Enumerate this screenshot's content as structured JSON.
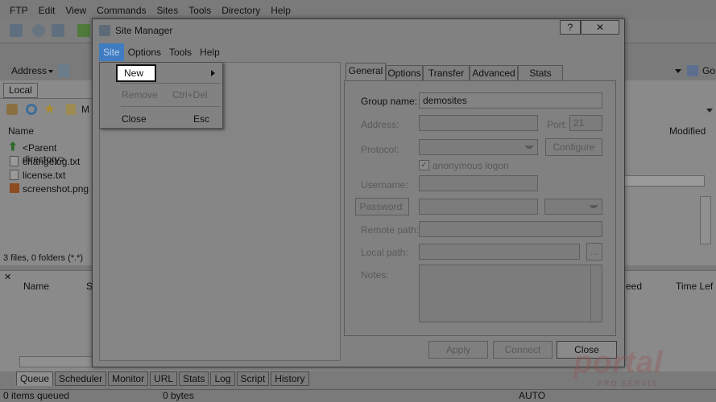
{
  "main_menu": [
    "FTP",
    "Edit",
    "View",
    "Commands",
    "Sites",
    "Tools",
    "Directory",
    "Help"
  ],
  "address_bar": {
    "label": "Address",
    "go_label": "Go"
  },
  "local_panel": {
    "tab": "Local",
    "path_short": "M",
    "column_name": "Name",
    "files": [
      "<Parent directory>",
      "changelog.txt",
      "license.txt",
      "screenshot.png"
    ],
    "status": "3 files, 0 folders (*.*)"
  },
  "remote_panel": {
    "column_modified": "Modified"
  },
  "queue": {
    "columns": [
      "Name",
      "S",
      "eed",
      "Time Lef"
    ],
    "tabs": [
      "Queue",
      "Scheduler",
      "Monitor",
      "URL",
      "Stats",
      "Log",
      "Script",
      "History"
    ],
    "status_items": "0 items queued",
    "status_bytes": "0 bytes",
    "status_mode": "AUTO"
  },
  "site_manager": {
    "title": "Site Manager",
    "help_btn": "?",
    "menu": [
      "Site",
      "Options",
      "Tools",
      "Help"
    ],
    "site_menu": {
      "new": "New",
      "remove": "Remove",
      "remove_shortcut": "Ctrl+Del",
      "close": "Close",
      "close_shortcut": "Esc"
    },
    "tabs": [
      "General",
      "Options",
      "Transfer",
      "Advanced",
      "Stats"
    ],
    "general": {
      "group_name_label": "Group name:",
      "group_name_value": "demosites",
      "address_label": "Address:",
      "port_label": "Port:",
      "port_value": "21",
      "protocol_label": "Protocol:",
      "configure_btn": "Configure",
      "anonymous_label": "anonymous logon",
      "username_label": "Username:",
      "password_btn": "Password:",
      "remote_path_label": "Remote path:",
      "local_path_label": "Local path:",
      "browse_btn": "...",
      "notes_label": "Notes:"
    },
    "buttons": {
      "apply": "Apply",
      "connect": "Connect",
      "close": "Close"
    }
  },
  "watermark": {
    "text": "portal",
    "sub": "PRO SERVIS"
  }
}
